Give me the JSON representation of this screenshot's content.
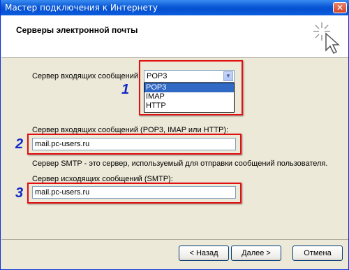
{
  "window": {
    "title": "Мастер подключения к Интернету",
    "close_symbol": "✕"
  },
  "header": {
    "title": "Серверы электронной почты",
    "icon": "wizard-cursor-icon"
  },
  "incoming_type": {
    "label": "Сервер входящих сообщений:",
    "selected": "POP3",
    "options": [
      "POP3",
      "IMAP",
      "HTTP"
    ]
  },
  "incoming_server": {
    "label": "Сервер входящих сообщений (POP3, IMAP или HTTP):",
    "value": "mail.pc-users.ru"
  },
  "smtp_note": "Сервер SMTP - это сервер, используемый для отправки сообщений  пользователя.",
  "outgoing_server": {
    "label": "Сервер исходящих сообщений (SMTP):",
    "value": "mail.pc-users.ru"
  },
  "annotations": [
    "1",
    "2",
    "3"
  ],
  "buttons": {
    "back": "< Назад",
    "next": "Далее >",
    "cancel": "Отмена"
  },
  "colors": {
    "annotation_box": "#e21010",
    "annotation_number": "#1428c8",
    "selection": "#316ac5"
  }
}
